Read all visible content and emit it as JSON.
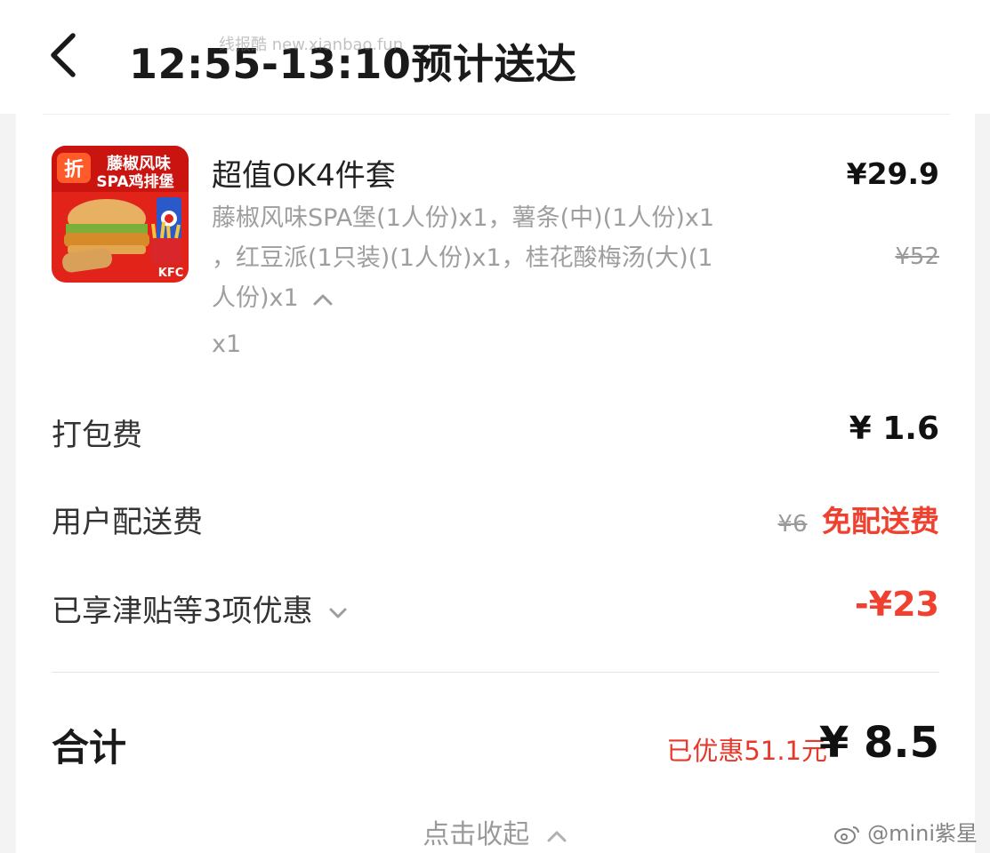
{
  "header": {
    "title": "12:55-13:10预计送达",
    "watermark": "线报酷  new.xianbao.fun"
  },
  "item": {
    "name": "超值OK4件套",
    "price": "¥29.9",
    "original_price": "¥52",
    "desc_lines": [
      "藤椒风味SPA堡(1人份)x1，薯条(中)(1人份)x1",
      "，红豆派(1只装)(1人份)x1，桂花酸梅汤(大)(1",
      "人份)x1"
    ],
    "quantity": "x1",
    "thumbnail": {
      "badge": "折",
      "caption_line1": "藤椒风味",
      "caption_line2": "SPA鸡排堡",
      "brand": "KFC"
    }
  },
  "fees": {
    "packing_label": "打包费",
    "packing_value": "¥ 1.6",
    "delivery_label": "用户配送费",
    "delivery_original": "¥6",
    "delivery_value": "免配送费",
    "discount_label": "已享津贴等3项优惠",
    "discount_value": "-¥23"
  },
  "total": {
    "label": "合计",
    "saved": "已优惠51.1元",
    "value": "¥ 8.5"
  },
  "collapse_label": "点击收起",
  "credit": "@mini紫星",
  "colors": {
    "accent_red": "#f0402f",
    "muted_text": "#9e9e9e",
    "background": "#f3f3f3"
  }
}
